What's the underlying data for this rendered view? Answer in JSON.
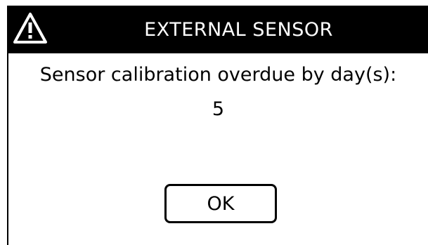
{
  "dialog": {
    "title": "EXTERNAL SENSOR",
    "title_icon": "warning-triangle-icon",
    "message": "Sensor calibration overdue by day(s):",
    "days_overdue": "5",
    "ok_label": "OK"
  },
  "colors": {
    "titlebar_background": "#000000",
    "titlebar_text": "#ffffff",
    "body_background": "#ffffff",
    "body_text": "#000000"
  }
}
